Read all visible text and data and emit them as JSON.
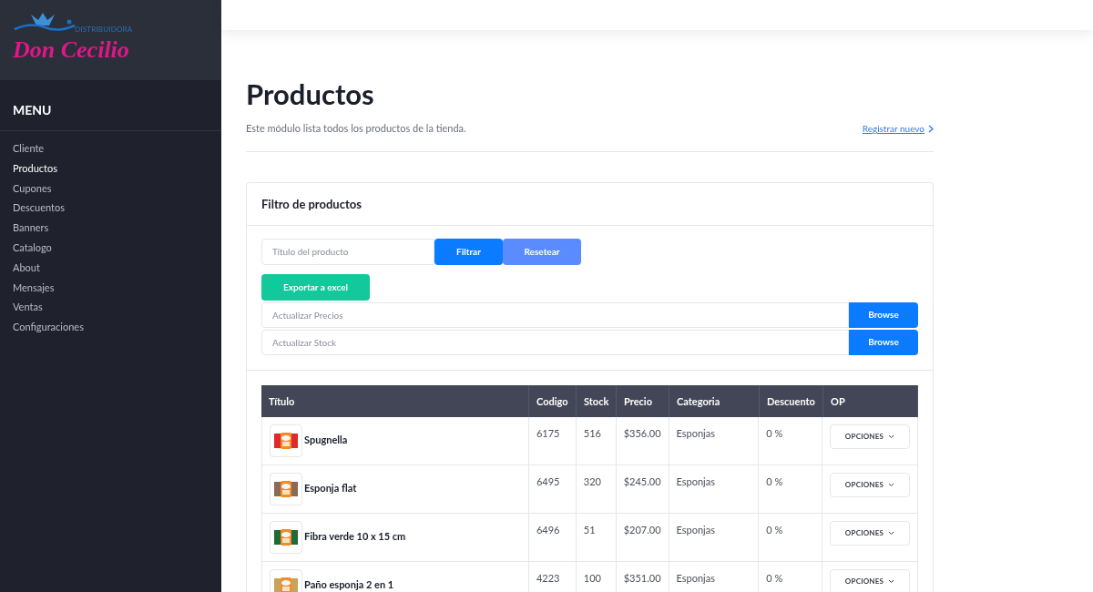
{
  "logo": {
    "small": "DISTRIBUIDORA",
    "name": "Don Cecilio"
  },
  "sidebar": {
    "heading": "MENU",
    "items": [
      {
        "label": "Cliente",
        "selected": false
      },
      {
        "label": "Productos",
        "selected": true
      },
      {
        "label": "Cupones",
        "selected": false
      },
      {
        "label": "Descuentos",
        "selected": false
      },
      {
        "label": "Banners",
        "selected": false
      },
      {
        "label": "Catalogo",
        "selected": false
      },
      {
        "label": "About",
        "selected": false
      },
      {
        "label": "Mensajes",
        "selected": false
      },
      {
        "label": "Ventas",
        "selected": false
      },
      {
        "label": "Configuraciones",
        "selected": false
      }
    ]
  },
  "page": {
    "title": "Productos",
    "subtitle": "Este módulo lista todos los productos de la tienda.",
    "link": "Registrar nuevo"
  },
  "filter": {
    "title": "Filtro de productos",
    "search": {
      "placeholder": "Título del producto"
    },
    "filter_button": "Filtrar",
    "reset_button": "Resetear",
    "export_button": "Exportar a excel",
    "uploads": [
      {
        "placeholder": "Actualizar Precios",
        "button": "Browse"
      },
      {
        "placeholder": "Actualizar Stock",
        "button": "Browse"
      }
    ]
  },
  "table": {
    "columns": [
      "Título",
      "Codigo",
      "Stock",
      "Precio",
      "Categoria",
      "Descuento",
      "OP"
    ],
    "rows": [
      {
        "title": "Spugnella",
        "code": "6175",
        "stock": "516",
        "price": "$356.00",
        "category": "Esponjas",
        "discount": "0 %",
        "action": "OPCIONES"
      },
      {
        "title": "Esponja flat",
        "code": "6495",
        "stock": "320",
        "price": "$245.00",
        "category": "Esponjas",
        "discount": "0 %",
        "action": "OPCIONES"
      },
      {
        "title": "Fibra verde 10 x 15 cm",
        "code": "6496",
        "stock": "51",
        "price": "$207.00",
        "category": "Esponjas",
        "discount": "0 %",
        "action": "OPCIONES"
      },
      {
        "title": "Paño esponja 2 en 1",
        "code": "4223",
        "stock": "100",
        "price": "$351.00",
        "category": "Esponjas",
        "discount": "0 %",
        "action": "OPCIONES"
      }
    ]
  }
}
